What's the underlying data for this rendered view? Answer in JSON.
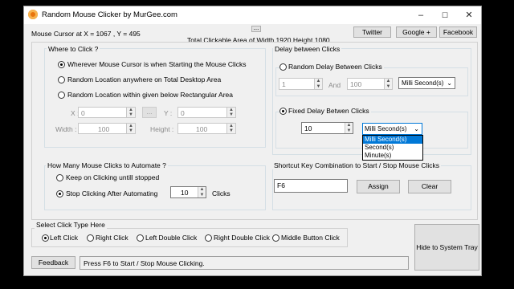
{
  "window": {
    "title": "Random Mouse Clicker by MurGee.com",
    "min": "–",
    "max": "☐",
    "close": "✕"
  },
  "top": {
    "cursor": "Mouse Cursor at X = 1067 , Y = 495",
    "area": "Total Clickable Area of Width 1920 Height 1080",
    "dots": "...",
    "twitter": "Twitter",
    "google": "Google +",
    "facebook": "Facebook"
  },
  "where": {
    "title": "Where to Click ?",
    "opt1": "Wherever Mouse Cursor is when Starting the Mouse Clicks",
    "opt2": "Random Location anywhere on Total Desktop Area",
    "opt3": "Random Location within given below Rectangular Area",
    "x_label": "X :",
    "x_value": "0",
    "y_label": "Y :",
    "y_value": "0",
    "dots": "...",
    "width_label": "Width :",
    "width_value": "100",
    "height_label": "Height :",
    "height_value": "100"
  },
  "delay": {
    "title": "Delay between Clicks",
    "random_label": "Random Delay Between Clicks",
    "from": "1",
    "and": "And",
    "to": "100",
    "random_unit": "Milli Second(s)",
    "fixed_label": "Fixed Delay Betwen Clicks",
    "fixed_value": "10",
    "fixed_unit": "Milli Second(s)",
    "options": [
      "Milli Second(s)",
      "Second(s)",
      "Minute(s)"
    ]
  },
  "howmany": {
    "title": "How Many Mouse Clicks to Automate ?",
    "keep": "Keep on Clicking untill stopped",
    "stop": "Stop Clicking After Automating",
    "count": "10",
    "clicks": "Clicks"
  },
  "shortcut": {
    "title": "Shortcut Key Combination to Start / Stop Mouse Clicks",
    "key": "F6",
    "assign": "Assign",
    "clear": "Clear"
  },
  "clicktype": {
    "title": "Select Click Type Here",
    "options": [
      "Left Click",
      "Right Click",
      "Left Double Click",
      "Right Double Click",
      "Middle Button Click"
    ]
  },
  "bottom": {
    "hide": "Hide to System Tray",
    "feedback": "Feedback",
    "status": "Press F6 to Start / Stop Mouse Clicking."
  },
  "colors": {
    "accent": "#0078d7",
    "app_icon": "#e8730c"
  }
}
